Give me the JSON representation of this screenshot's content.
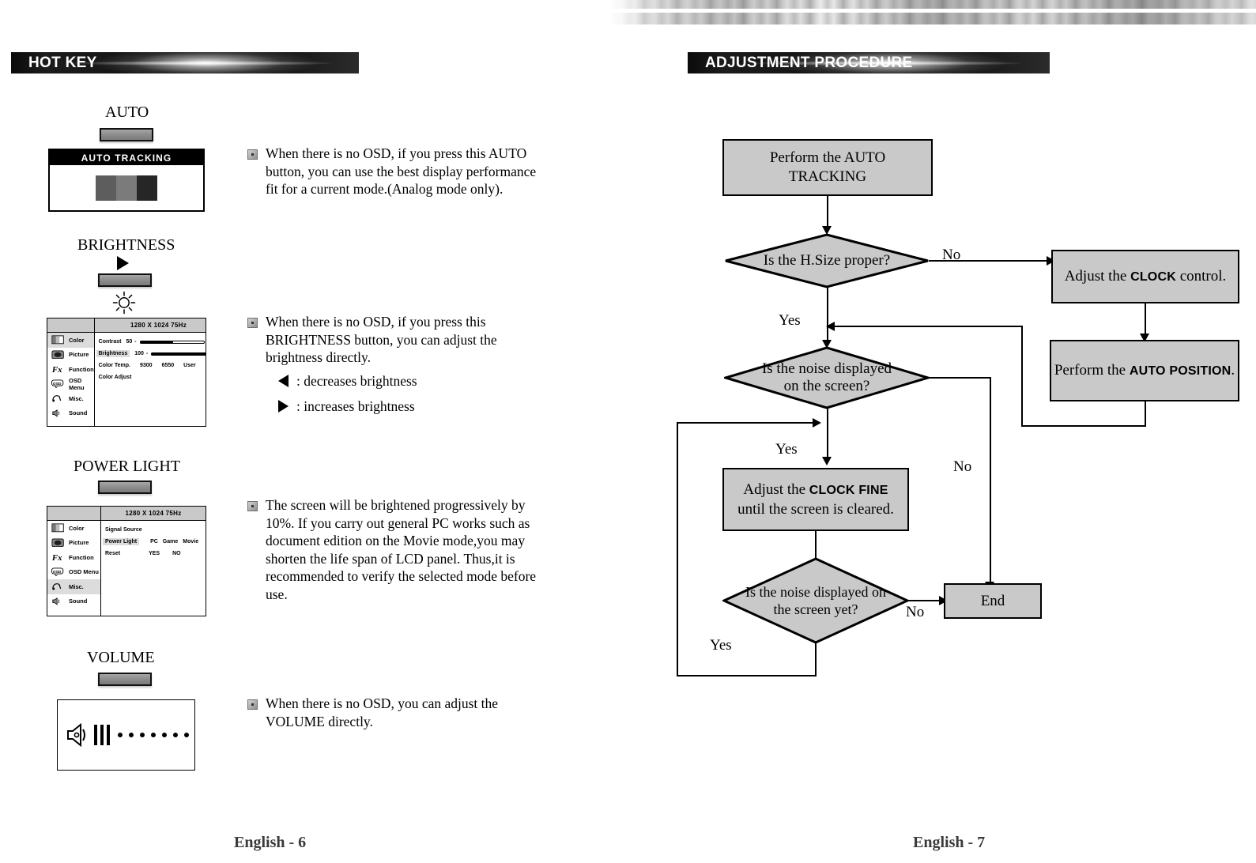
{
  "left_page": {
    "section_title": "HOT KEY",
    "footer": "English - 6",
    "sections": [
      {
        "button_label": "AUTO",
        "osd": {
          "type": "auto-tracking",
          "header": "AUTO TRACKING"
        },
        "note": "When there is no OSD, if you press this AUTO button, you can use the best display performance fit  for a current mode.(Analog mode only)."
      },
      {
        "button_label": "BRIGHTNESS",
        "icon": "sun-icon",
        "note": "When there is no OSD, if you press this BRIGHTNESS button, you can adjust the brightness directly.",
        "sub_notes": [
          {
            "arrow": "left-triangle-icon",
            "text": ":  decreases brightness"
          },
          {
            "arrow": "right-triangle-icon",
            "text": ":  increases brightness"
          }
        ],
        "osd": {
          "title": "1280 X 1024    75Hz",
          "menu": [
            {
              "label": "Color",
              "icon": "color-icon",
              "selected": true
            },
            {
              "label": "Picture",
              "icon": "picture-icon",
              "selected": false
            },
            {
              "label": "Function",
              "icon": "function-fx-icon",
              "selected": false
            },
            {
              "label": "OSD Menu",
              "icon": "osd-icon",
              "selected": false
            },
            {
              "label": "Misc.",
              "icon": "misc-icon",
              "selected": false
            },
            {
              "label": "Sound",
              "icon": "sound-speaker-icon",
              "selected": false
            }
          ],
          "rows": [
            {
              "label": "Contrast",
              "value": "50",
              "slider": 52,
              "highlight": false
            },
            {
              "label": "Brightness",
              "value": "100",
              "slider": 100,
              "highlight": true
            },
            {
              "label": "Color Temp.",
              "options": [
                "9300",
                "6550",
                "User"
              ]
            },
            {
              "label": "Color Adjust"
            }
          ]
        }
      },
      {
        "button_label": "POWER LIGHT",
        "note": "The screen will be brightened progressively by 10%. If you carry out general PC works such as document edition on the Movie mode,you may shorten the life span of LCD panel. Thus,it is recommended to verify the selected mode before use.",
        "osd": {
          "title": "1280 X 1024    75Hz",
          "menu": [
            {
              "label": "Color",
              "icon": "color-icon",
              "selected": false
            },
            {
              "label": "Picture",
              "icon": "picture-icon",
              "selected": false
            },
            {
              "label": "Function",
              "icon": "function-fx-icon",
              "selected": false
            },
            {
              "label": "OSD Menu",
              "icon": "osd-icon",
              "selected": false
            },
            {
              "label": "Misc.",
              "icon": "misc-icon",
              "selected": true
            },
            {
              "label": "Sound",
              "icon": "sound-speaker-icon",
              "selected": false
            }
          ],
          "rows": [
            {
              "label": "Signal Source"
            },
            {
              "label": "Power Light",
              "options": [
                "PC",
                "Game",
                "Movie"
              ],
              "highlight": true
            },
            {
              "label": "Reset",
              "options": [
                "YES",
                "NO"
              ]
            }
          ]
        }
      },
      {
        "button_label": "VOLUME",
        "note": "When there is no OSD, you can adjust the VOLUME directly.",
        "osd": {
          "type": "volume",
          "icon": "speaker-icon",
          "filled_bars": 3,
          "empty_dots": 7
        }
      }
    ]
  },
  "right_page": {
    "section_title": "ADJUSTMENT PROCEDURE",
    "footer": "English - 7",
    "flowchart": {
      "nodes": [
        {
          "id": "start",
          "shape": "process",
          "text_lines": [
            "Perform the AUTO",
            "TRACKING"
          ]
        },
        {
          "id": "q_hsize",
          "shape": "decision",
          "text_lines": [
            "Is the H.Size proper?"
          ]
        },
        {
          "id": "adj_clock",
          "shape": "process",
          "text_parts": [
            "Adjust the ",
            "CLOCK",
            " control."
          ]
        },
        {
          "id": "auto_position",
          "shape": "process",
          "text_parts": [
            "Perform the ",
            "AUTO POSITION",
            "."
          ]
        },
        {
          "id": "q_noise",
          "shape": "decision",
          "text_lines": [
            "Is the noise displayed",
            "on the screen?"
          ]
        },
        {
          "id": "adj_clock_fine",
          "shape": "process",
          "text_parts": [
            "Adjust the ",
            "CLOCK FINE",
            " until the screen is cleared."
          ]
        },
        {
          "id": "q_noise_yet",
          "shape": "decision",
          "text_lines": [
            "Is the noise displayed on",
            "the screen yet?"
          ]
        },
        {
          "id": "end",
          "shape": "process",
          "text_lines": [
            "End"
          ]
        }
      ],
      "edge_labels": {
        "hsize_no": "No",
        "hsize_yes": "Yes",
        "noise_yes": "Yes",
        "noise_no": "No",
        "noiseyet_no": "No",
        "noiseyet_yes": "Yes"
      }
    }
  },
  "colors": {
    "node_fill": "#c9c9c9",
    "node_stroke": "#000000",
    "title_bar_bg": "#101010",
    "title_bar_text": "#ffffff",
    "osd_header": "#c9c9c9",
    "osd_selected": "#dcdcdc"
  }
}
